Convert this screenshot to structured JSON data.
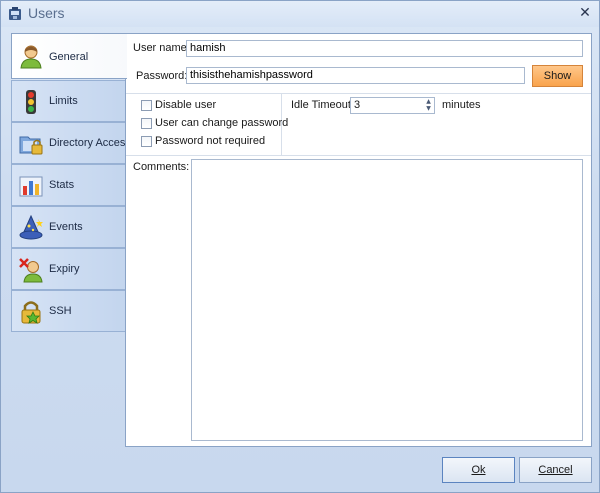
{
  "window": {
    "title": "Users",
    "close_glyph": "✕"
  },
  "tabs": [
    {
      "label": "General",
      "icon": "user-icon",
      "active": true
    },
    {
      "label": "Limits",
      "icon": "traffic-light-icon",
      "active": false
    },
    {
      "label": "Directory Access",
      "icon": "folder-lock-icon",
      "active": false
    },
    {
      "label": "Stats",
      "icon": "bar-chart-icon",
      "active": false
    },
    {
      "label": "Events",
      "icon": "wizard-hat-icon",
      "active": false
    },
    {
      "label": "Expiry",
      "icon": "user-expired-icon",
      "active": false
    },
    {
      "label": "SSH",
      "icon": "padlock-star-icon",
      "active": false
    }
  ],
  "general": {
    "username_label": "User name:",
    "username_value": "hamish",
    "password_label": "Password:",
    "password_value": "thisisthehamishpassword",
    "show_button": "Show",
    "checkboxes": [
      {
        "label": "Disable user",
        "checked": false
      },
      {
        "label": "User can change password",
        "checked": false
      },
      {
        "label": "Password not required",
        "checked": false
      }
    ],
    "idle_timeout_label": "Idle Timeout:",
    "idle_timeout_value": "3",
    "idle_timeout_unit": "minutes",
    "comments_label": "Comments:",
    "comments_value": ""
  },
  "footer": {
    "ok_label": "Ok",
    "cancel_label": "Cancel"
  },
  "colors": {
    "accent": "#f9a34c",
    "border": "#8aa3c6",
    "background": "#cddcf0"
  }
}
